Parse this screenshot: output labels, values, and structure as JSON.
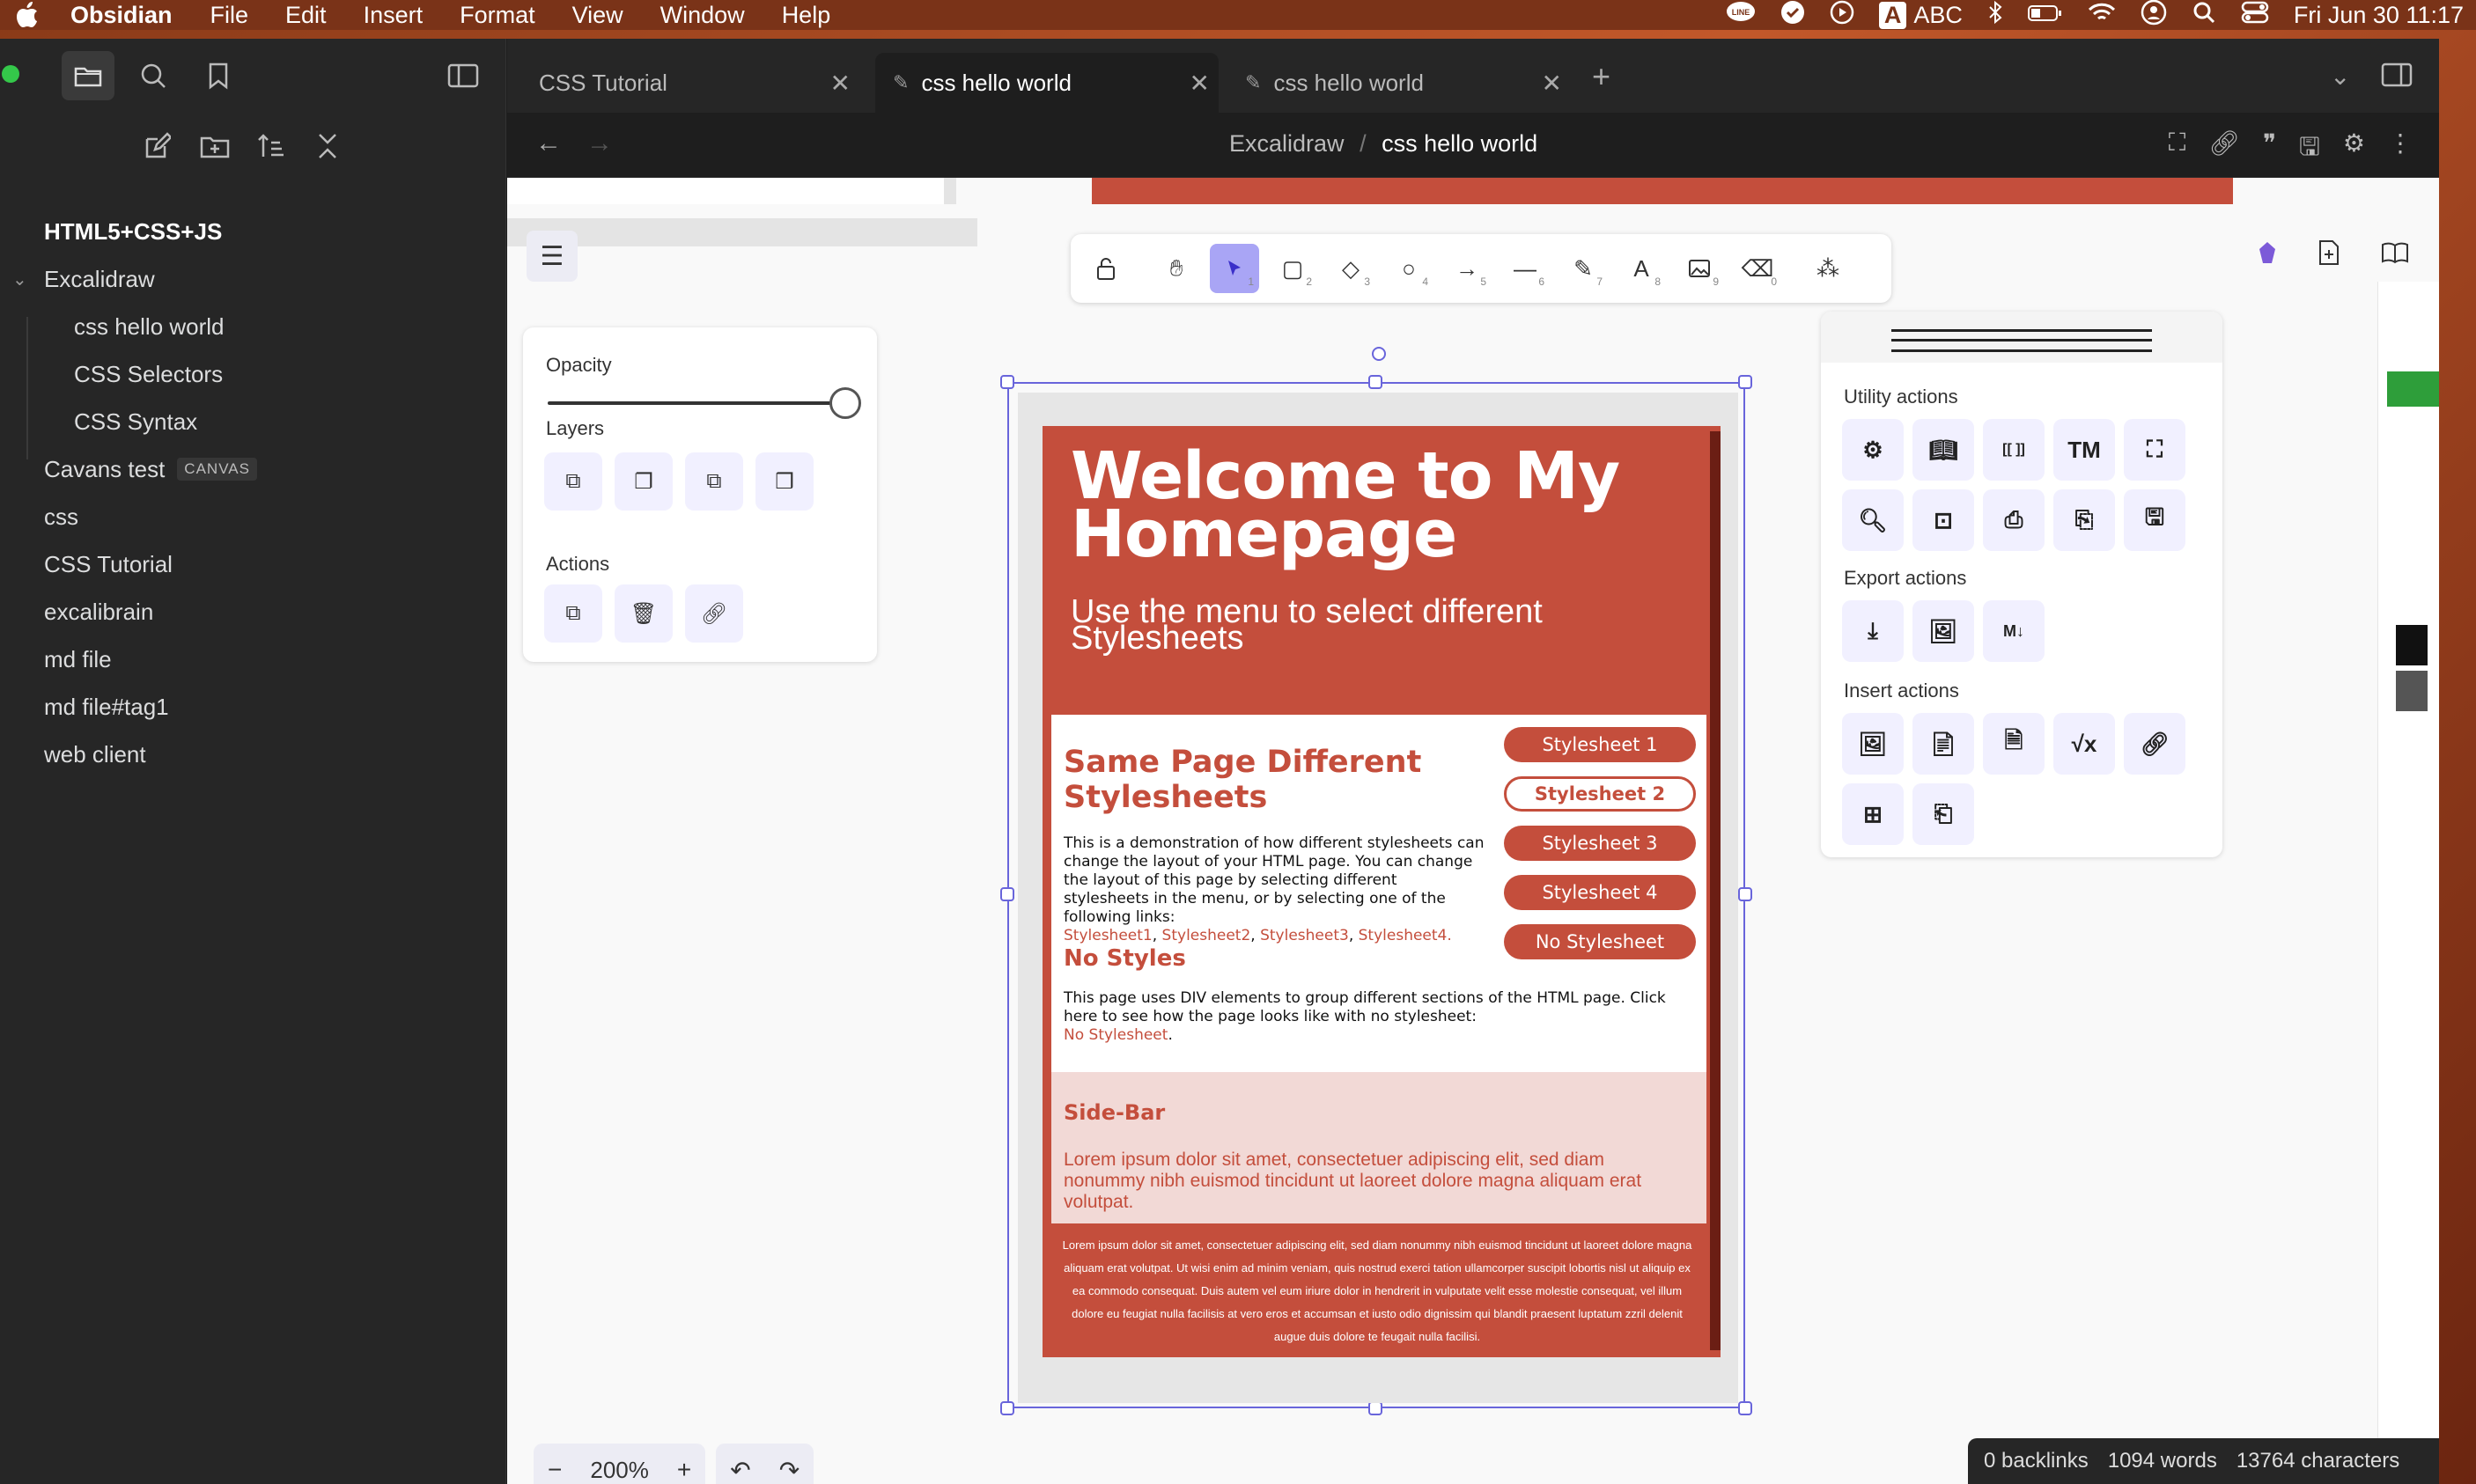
{
  "menubar": {
    "app_name": "Obsidian",
    "menus": [
      "File",
      "Edit",
      "Insert",
      "Format",
      "View",
      "Window",
      "Help"
    ],
    "input_source_letter": "A",
    "input_source": "ABC",
    "clock": "Fri Jun 30  11:17"
  },
  "tabs": [
    {
      "label": "CSS Tutorial",
      "active": false
    },
    {
      "label": "css hello world",
      "active": true
    },
    {
      "label": "css hello world",
      "active": false
    }
  ],
  "file_tree": {
    "vault": "HTML5+CSS+JS",
    "folder": "Excalidraw",
    "folder_children": [
      "css hello world",
      "CSS Selectors",
      "CSS Syntax"
    ],
    "canvas_item": "Cavans test",
    "canvas_badge": "CANVAS",
    "items": [
      "css",
      "CSS Tutorial",
      "excalibrain",
      "md file",
      "md file#tag1",
      "web client"
    ]
  },
  "breadcrumb": {
    "parent": "Excalidraw",
    "separator": "/",
    "current": "css hello world"
  },
  "props_panel": {
    "opacity_label": "Opacity",
    "opacity_value": 1.0,
    "layers_label": "Layers",
    "actions_label": "Actions"
  },
  "utility_panel": {
    "utility_label": "Utility actions",
    "export_label": "Export actions",
    "insert_label": "Insert actions",
    "tm_label": "TM",
    "md_label": "M↓"
  },
  "embedded_page": {
    "title": "Welcome to My Homepage",
    "subtitle": "Use the menu to select different Stylesheets",
    "heading": "Same Page Different Stylesheets",
    "description": "This is a demonstration of how different stylesheets can change the layout of your HTML page. You can change the layout of this page by selecting different stylesheets in the menu, or by selecting one of the following links:",
    "links": [
      "Stylesheet1",
      "Stylesheet2",
      "Stylesheet3",
      "Stylesheet4."
    ],
    "no_styles_heading": "No Styles",
    "no_styles_text": "This page uses DIV elements to group different sections of the HTML page. Click here to see how the page looks like with no stylesheet:",
    "no_styles_link": "No Stylesheet",
    "menu_buttons": [
      "Stylesheet 1",
      "Stylesheet 2",
      "Stylesheet 3",
      "Stylesheet 4",
      "No Stylesheet"
    ],
    "sidebar_title": "Side-Bar",
    "sidebar_text": "Lorem ipsum dolor sit amet, consectetuer adipiscing elit, sed diam nonummy nibh euismod tincidunt ut laoreet dolore magna aliquam erat volutpat.",
    "footer_text": "Lorem ipsum dolor sit amet, consectetuer adipiscing elit, sed diam nonummy nibh euismod tincidunt ut laoreet dolore magna aliquam erat volutpat. Ut wisi enim ad minim veniam, quis nostrud exerci tation ullamcorper suscipit lobortis nisl ut aliquip ex ea commodo consequat. Duis autem vel eum iriure dolor in hendrerit in vulputate velit esse molestie consequat, vel illum dolore eu feugiat nulla facilisis at vero eros et accumsan et iusto odio dignissim qui blandit praesent luptatum zzril delenit augue duis dolore te feugait nulla facilisi."
  },
  "zoom": {
    "value": "200%"
  },
  "status_bar": {
    "backlinks": "0 backlinks",
    "words": "1094 words",
    "characters": "13764 characters"
  },
  "colors": {
    "accent": "#6965db",
    "page_red": "#c44e3c",
    "selected_tool": "#a9a5f5"
  }
}
